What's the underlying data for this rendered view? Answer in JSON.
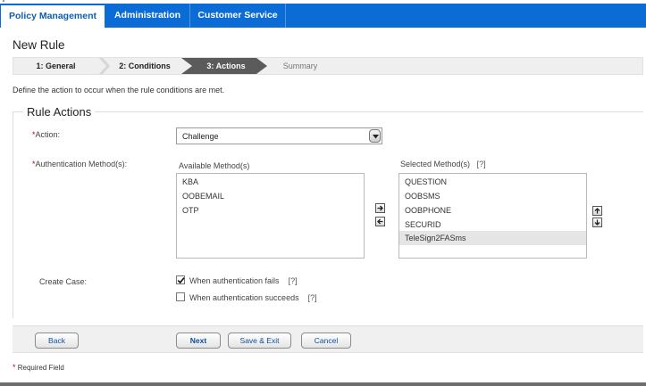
{
  "nav": {
    "tabs": [
      {
        "label": "Policy Management",
        "active": true
      },
      {
        "label": "Administration",
        "active": false
      },
      {
        "label": "Customer Service",
        "active": false
      }
    ]
  },
  "page": {
    "title": "New Rule",
    "instruction": "Define the action to occur when the rule conditions are met."
  },
  "wizard": {
    "steps": [
      {
        "label": "1: General",
        "state": "done"
      },
      {
        "label": "2: Conditions",
        "state": "done"
      },
      {
        "label": "3: Actions",
        "state": "current"
      },
      {
        "label": "Summary",
        "state": "future"
      }
    ]
  },
  "rule_actions": {
    "legend": "Rule Actions",
    "required_marker": "*",
    "action_label": "Action:",
    "action_value": "Challenge",
    "auth_label": "Authentication Method(s):",
    "available_label": "Available Method(s)",
    "selected_label": "Selected Method(s)",
    "selected_help": "[?]",
    "available": [
      "KBA",
      "OOBEMAIL",
      "OTP"
    ],
    "selected": [
      "QUESTION",
      "OOBSMS",
      "OOBPHONE",
      "SECURID",
      "TeleSign2FASms"
    ],
    "selected_highlight_index": 4,
    "create_case_label": "Create Case:",
    "checkbox_fail_label": "When authentication fails",
    "checkbox_fail_checked": true,
    "checkbox_fail_help": "[?]",
    "checkbox_success_label": "When authentication succeeds",
    "checkbox_success_checked": false,
    "checkbox_success_help": "[?]"
  },
  "buttons": {
    "back": "Back",
    "next": "Next",
    "save_exit": "Save & Exit",
    "cancel": "Cancel"
  },
  "footer": {
    "required_marker": "*",
    "required_note": "Required Field"
  },
  "colors": {
    "nav_blue": "#0a6cd4",
    "step_current": "#5b5b5b",
    "required_red": "#cc0000",
    "link_blue": "#0b4f9c"
  },
  "icons": {
    "move_right": "arrow-right-icon",
    "move_left": "arrow-left-icon",
    "move_up": "arrow-up-icon",
    "move_down": "arrow-down-icon",
    "dropdown": "chevron-down-icon",
    "check": "check-icon"
  }
}
